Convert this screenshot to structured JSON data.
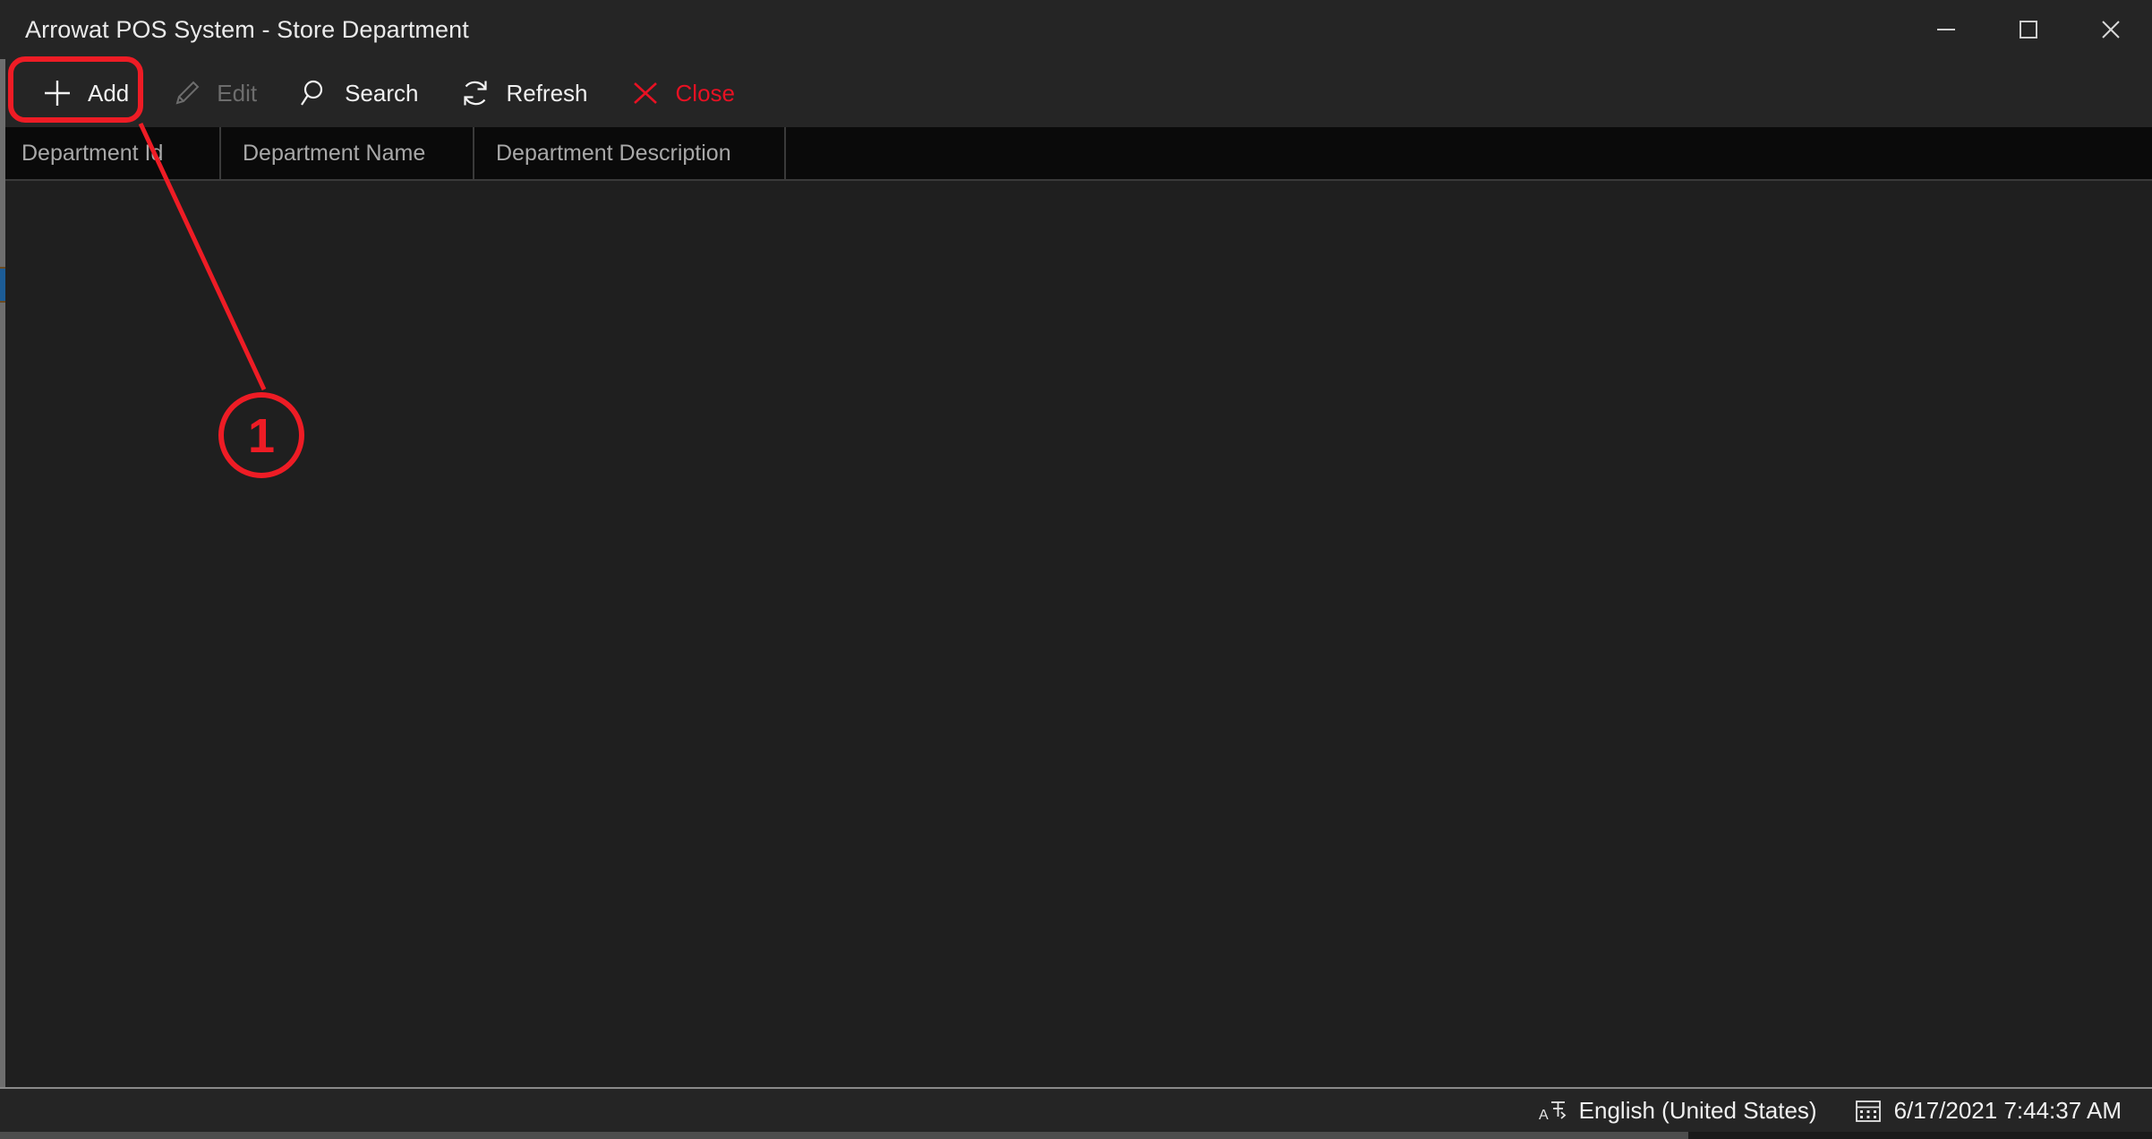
{
  "window": {
    "title": "Arrowat POS System - Store Department",
    "controls": [
      {
        "name": "minimize",
        "glyph": "minimize-icon"
      },
      {
        "name": "maximize",
        "glyph": "maximize-icon"
      },
      {
        "name": "close",
        "glyph": "close-icon"
      }
    ]
  },
  "toolbar": {
    "items": [
      {
        "label": "Add",
        "icon": "plus-icon",
        "state": "highlighted"
      },
      {
        "label": "Edit",
        "icon": "pencil-icon",
        "state": "disabled"
      },
      {
        "label": "Search",
        "icon": "magnifier-icon",
        "state": "normal"
      },
      {
        "label": "Refresh",
        "icon": "refresh-icon",
        "state": "normal"
      },
      {
        "label": "Close",
        "icon": "x-icon",
        "state": "danger"
      }
    ]
  },
  "grid": {
    "columns": [
      {
        "label": "Department Id"
      },
      {
        "label": "Department Name"
      },
      {
        "label": "Department Description"
      },
      {
        "label": ""
      }
    ],
    "rows": []
  },
  "statusbar": {
    "language_icon": "keyboard-language-icon",
    "language": "English (United States)",
    "date_icon": "calendar-icon",
    "datetime": "6/17/2021 7:44:37 AM"
  },
  "annotation": {
    "step_number": "1",
    "color": "#ee1c25",
    "target": "Add"
  },
  "colors": {
    "window_chrome": "#252525",
    "grid_background": "#1f1f1f",
    "grid_header": "#0a0a0a",
    "accent_danger": "#e81123",
    "annotation_red": "#ee1c25"
  }
}
